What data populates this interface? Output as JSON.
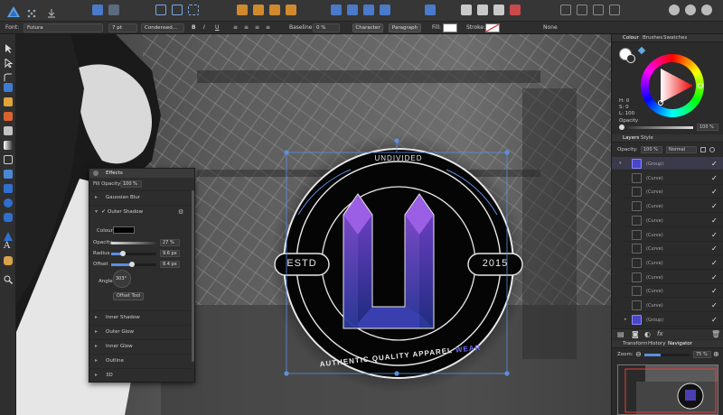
{
  "toolbar": {
    "icons": [
      "persona-designer-icon",
      "persona-pixel-icon",
      "persona-export-icon",
      "snapping-icon",
      "align-icon",
      "boolean-icon",
      "arrange-icon",
      "flip-icon",
      "transform-icon",
      "assistant-icon",
      "view-mode-icon"
    ]
  },
  "context": {
    "font_label": "Font:",
    "font_value": "Futura",
    "size_value": "7 pt",
    "style_value": "Condensed...",
    "bold": "B",
    "italic": "I",
    "underline": "U",
    "baseline_label": "Baseline:",
    "baseline_value": "0 %",
    "character_button": "Character",
    "paragraph_button": "Paragraph",
    "fill_label": "Fill:",
    "stroke_label": "Stroke:",
    "stroke_value": "None"
  },
  "effects": {
    "title": "Effects",
    "fill_opacity_label": "Fill Opacity:",
    "fill_opacity_value": "100 %",
    "gaussian_blur": "Gaussian Blur",
    "outer_shadow": "Outer Shadow",
    "colour_label": "Colour",
    "opacity_label": "Opacity",
    "opacity_value": "27 %",
    "radius_label": "Radius",
    "radius_value": "9.6 px",
    "offset_label": "Offset",
    "offset_value": "8.4 px",
    "angle_label": "Angle",
    "angle_value": "303°",
    "offset_tool_button": "Offset Tool",
    "inner_shadow": "Inner Shadow",
    "outer_glow": "Outer Glow",
    "inner_glow": "Inner Glow",
    "outline": "Outline",
    "three_d": "3D"
  },
  "logo": {
    "top_text": "UNDIVIDED",
    "left_text": "ESTD",
    "right_text": "2015",
    "bottom_text_main": "AUTHENTIC QUALITY APPAREL",
    "bottom_text_accent": "WEAR",
    "accent_color": "#5b5bd6",
    "purple_color": "#7c3fc8"
  },
  "colour_panel": {
    "tabs": [
      "Colour",
      "Brushes",
      "Swatches"
    ],
    "h_label": "H: 0",
    "s_label": "S: 0",
    "l_label": "L: 100",
    "opacity_label": "Opacity",
    "opacity_value": "100 %"
  },
  "layers_panel": {
    "tabs": [
      "Layers",
      "Style"
    ],
    "opacity_label": "Opacity:",
    "opacity_value": "100 %",
    "blend_mode": "Normal",
    "rows": [
      {
        "name": "(Group)",
        "top": true
      },
      {
        "name": "(Curve)"
      },
      {
        "name": "(Curve)"
      },
      {
        "name": "(Curve)"
      },
      {
        "name": "(Curve)"
      },
      {
        "name": "(Curve)"
      },
      {
        "name": "(Curve)"
      },
      {
        "name": "(Curve)"
      },
      {
        "name": "(Curve)"
      },
      {
        "name": "(Curve)"
      },
      {
        "name": "(Curve)"
      },
      {
        "name": "(Group)"
      }
    ]
  },
  "navigator_panel": {
    "tabs": [
      "Transform",
      "History",
      "Navigator"
    ],
    "zoom_label": "Zoom:",
    "zoom_value": "75 %"
  }
}
